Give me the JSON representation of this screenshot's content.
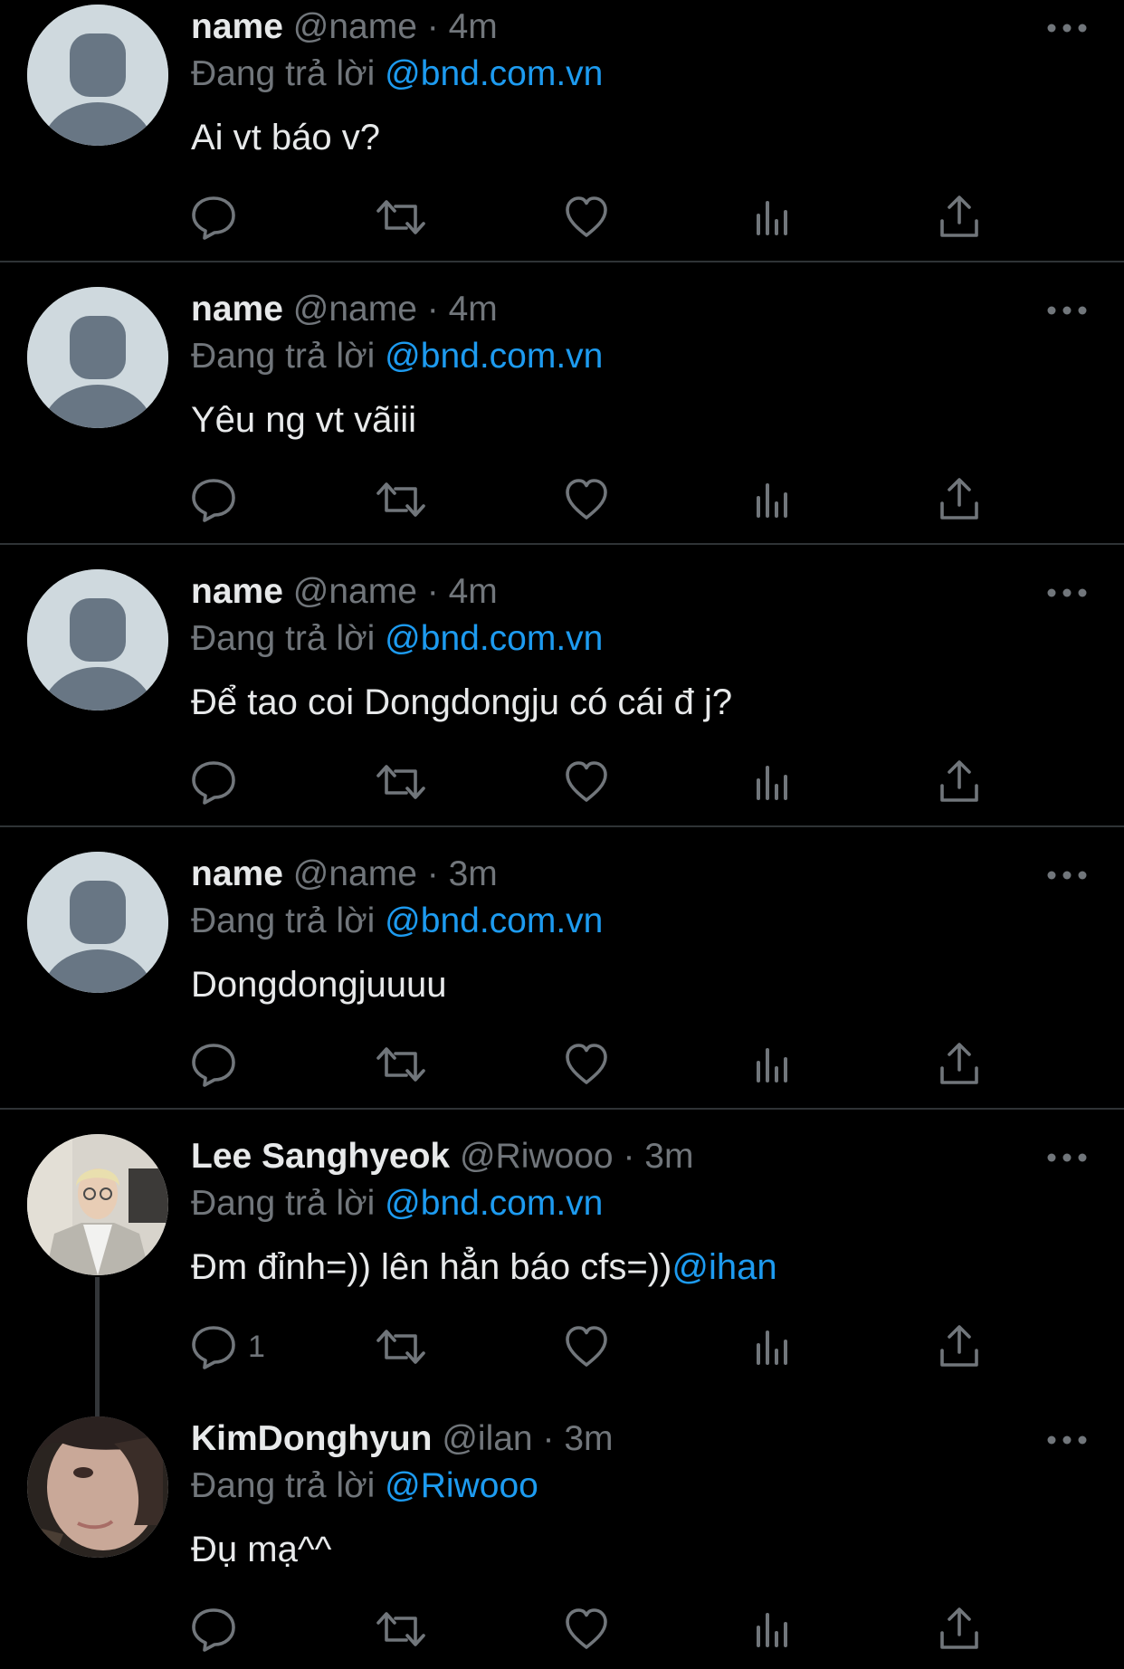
{
  "colors": {
    "background": "#000000",
    "text": "#e7e9ea",
    "secondary_text": "#71767b",
    "accent_link": "#1d9bf0",
    "divider": "#2f3336",
    "default_avatar_bg": "#cfd9de",
    "default_avatar_silhouette": "#687684"
  },
  "icons": {
    "reply": "speech-bubble-icon",
    "retweet": "retweet-arrows-icon",
    "like": "heart-outline-icon",
    "views": "bar-chart-icon",
    "share": "upload-arrow-icon",
    "more": "three-dots-icon"
  },
  "tweets": [
    {
      "display_name": "name",
      "handle": "@name",
      "separator": "·",
      "time": "4m",
      "reply_prefix": "Đang trả lời",
      "reply_to": "@bnd.com.vn",
      "text": "Ai vt báo v?",
      "reply_count": ""
    },
    {
      "display_name": "name",
      "handle": "@name",
      "separator": "·",
      "time": "4m",
      "reply_prefix": "Đang trả lời",
      "reply_to": "@bnd.com.vn",
      "text": "Yêu ng vt vãiii",
      "reply_count": ""
    },
    {
      "display_name": "name",
      "handle": "@name",
      "separator": "·",
      "time": "4m",
      "reply_prefix": "Đang trả lời",
      "reply_to": "@bnd.com.vn",
      "text": "Để tao coi Dongdongju có cái đ j?",
      "reply_count": ""
    },
    {
      "display_name": "name",
      "handle": "@name",
      "separator": "·",
      "time": "3m",
      "reply_prefix": "Đang trả lời",
      "reply_to": "@bnd.com.vn",
      "text": "Dongdongjuuuu",
      "reply_count": ""
    },
    {
      "display_name": "Lee Sanghyeok",
      "handle": "@Riwooo",
      "separator": "·",
      "time": "3m",
      "reply_prefix": "Đang trả lời",
      "reply_to": "@bnd.com.vn",
      "text": "Đm đỉnh=)) lên hẳn báo cfs=))",
      "text_mention": "@ihan",
      "reply_count": "1"
    },
    {
      "display_name": "KimDonghyun",
      "handle": "@ilan",
      "separator": "·",
      "time": "3m",
      "reply_prefix": "Đang trả lời",
      "reply_to": "@Riwooo",
      "text": "Đụ mạ^^",
      "reply_count": ""
    }
  ]
}
